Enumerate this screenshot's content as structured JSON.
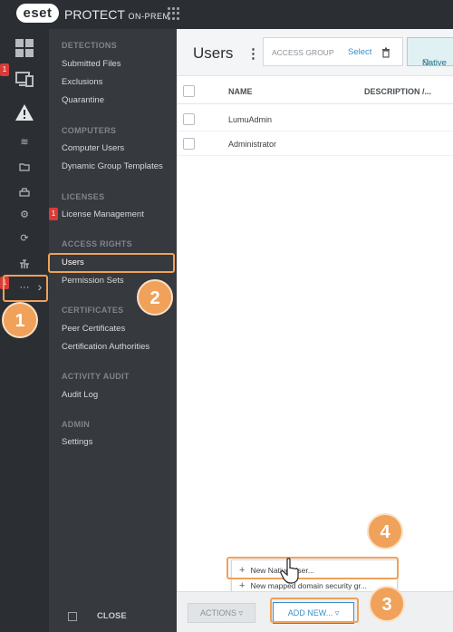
{
  "topbar": {
    "logo": "eset",
    "product": "PROTECT",
    "product_suffix": "ON-PREM"
  },
  "rail": {
    "badges": [
      "1",
      "1"
    ],
    "more_label": "···"
  },
  "menu": {
    "sections": [
      {
        "heading": "DETECTIONS",
        "items": [
          "Submitted Files",
          "Exclusions",
          "Quarantine"
        ]
      },
      {
        "heading": "COMPUTERS",
        "items": [
          "Computer Users",
          "Dynamic Group Templates"
        ]
      },
      {
        "heading": "LICENSES",
        "items": [
          "License Management"
        ]
      },
      {
        "heading": "ACCESS RIGHTS",
        "items": [
          "Users",
          "Permission Sets"
        ]
      },
      {
        "heading": "CERTIFICATES",
        "items": [
          "Peer Certificates",
          "Certification Authorities"
        ]
      },
      {
        "heading": "ACTIVITY AUDIT",
        "items": [
          "Audit Log"
        ]
      },
      {
        "heading": "ADMIN",
        "items": [
          "Settings"
        ]
      }
    ],
    "license_badge": "1",
    "close_label": "CLOSE"
  },
  "main": {
    "title": "Users",
    "filter": {
      "label": "ACCESS GROUP",
      "select": "Select"
    },
    "native_chip": "Native",
    "columns": [
      "NAME",
      "DESCRIPTION /..."
    ],
    "rows": [
      "LumuAdmin",
      "Administrator"
    ]
  },
  "dropdown": {
    "items": [
      "New Native User...",
      "New mapped domain security gr..."
    ]
  },
  "bottombar": {
    "actions_label": "ACTIONS",
    "addnew_label": "ADD NEW..."
  },
  "steps": [
    "1",
    "2",
    "3",
    "4"
  ],
  "colors": {
    "accent": "#f0a15a",
    "link": "#3b8ec9",
    "sidebar": "#2b2f33",
    "menu": "#36393d",
    "badge": "#d93b3b"
  }
}
